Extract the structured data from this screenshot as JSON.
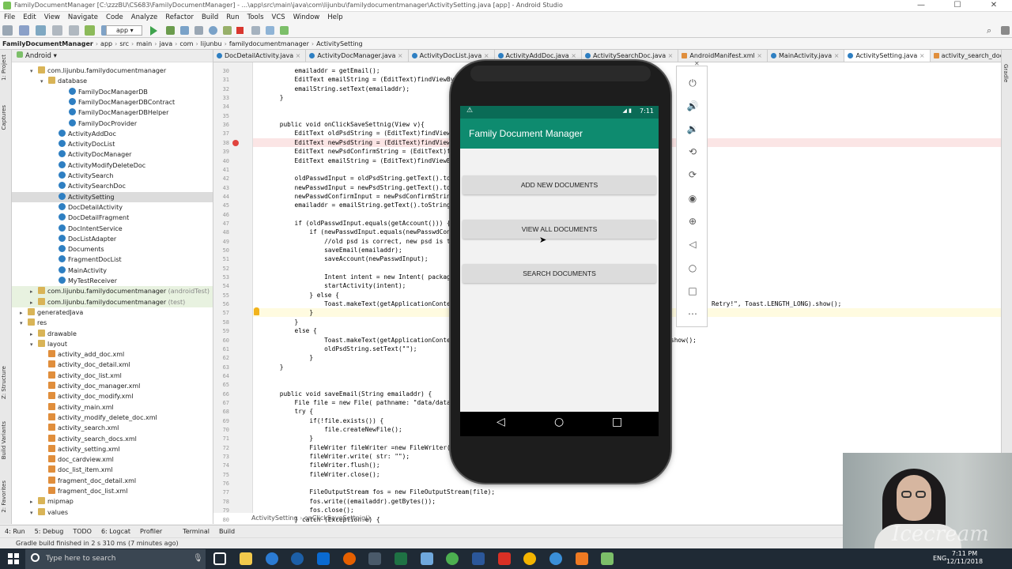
{
  "window": {
    "title": "FamilyDocumentManager [C:\\zzzBU\\CS683\\FamilyDocumentManager] - ...\\app\\src\\main\\java\\com\\lijunbu\\familydocumentmanager\\ActivitySetting.java [app] - Android Studio"
  },
  "menu": [
    "File",
    "Edit",
    "View",
    "Navigate",
    "Code",
    "Analyze",
    "Refactor",
    "Build",
    "Run",
    "Tools",
    "VCS",
    "Window",
    "Help"
  ],
  "toolbar": {
    "run_config": "app"
  },
  "navbar": [
    "FamilyDocumentManager",
    "app",
    "src",
    "main",
    "java",
    "com",
    "lijunbu",
    "familydocumentmanager",
    "ActivitySetting"
  ],
  "project": {
    "view": "Android",
    "rows": [
      {
        "t": "com.lijunbu.familydocumentmanager",
        "k": "f",
        "i": 1,
        "a": "▾"
      },
      {
        "t": "database",
        "k": "f",
        "i": 2,
        "a": "▾"
      },
      {
        "t": "FamilyDocManagerDB",
        "k": "c",
        "i": 4
      },
      {
        "t": "FamilyDocManagerDBContract",
        "k": "c",
        "i": 4
      },
      {
        "t": "FamilyDocManagerDBHelper",
        "k": "c",
        "i": 4
      },
      {
        "t": "FamilyDocProvider",
        "k": "c",
        "i": 4
      },
      {
        "t": "ActivityAddDoc",
        "k": "c",
        "i": 3
      },
      {
        "t": "ActivityDocList",
        "k": "c",
        "i": 3
      },
      {
        "t": "ActivityDocManager",
        "k": "c",
        "i": 3
      },
      {
        "t": "ActivityModifyDeleteDoc",
        "k": "c",
        "i": 3
      },
      {
        "t": "ActivitySearch",
        "k": "c",
        "i": 3
      },
      {
        "t": "ActivitySearchDoc",
        "k": "c",
        "i": 3
      },
      {
        "t": "ActivitySetting",
        "k": "c",
        "i": 3
      },
      {
        "t": "DocDetailActivity",
        "k": "c",
        "i": 3
      },
      {
        "t": "DocDetailFragment",
        "k": "c",
        "i": 3
      },
      {
        "t": "DocIntentService",
        "k": "c",
        "i": 3
      },
      {
        "t": "DocListAdapter",
        "k": "c",
        "i": 3
      },
      {
        "t": "Documents",
        "k": "c",
        "i": 3
      },
      {
        "t": "FragmentDocList",
        "k": "c",
        "i": 3
      },
      {
        "t": "MainActivity",
        "k": "c",
        "i": 3
      },
      {
        "t": "MyTestReceiver",
        "k": "c",
        "i": 3
      },
      {
        "t": "com.lijunbu.familydocumentmanager",
        "m": " (androidTest)",
        "k": "f",
        "i": 1,
        "a": "▸",
        "hl": true
      },
      {
        "t": "com.lijunbu.familydocumentmanager",
        "m": " (test)",
        "k": "f",
        "i": 1,
        "a": "▸",
        "hl": true
      },
      {
        "t": "generatedJava",
        "k": "f",
        "i": 0,
        "a": "▸"
      },
      {
        "t": "res",
        "k": "f",
        "i": 0,
        "a": "▾"
      },
      {
        "t": "drawable",
        "k": "f",
        "i": 1,
        "a": "▸"
      },
      {
        "t": "layout",
        "k": "f",
        "i": 1,
        "a": "▾"
      },
      {
        "t": "activity_add_doc.xml",
        "k": "x",
        "i": 2
      },
      {
        "t": "activity_doc_detail.xml",
        "k": "x",
        "i": 2
      },
      {
        "t": "activity_doc_list.xml",
        "k": "x",
        "i": 2
      },
      {
        "t": "activity_doc_manager.xml",
        "k": "x",
        "i": 2
      },
      {
        "t": "activity_doc_modify.xml",
        "k": "x",
        "i": 2
      },
      {
        "t": "activity_main.xml",
        "k": "x",
        "i": 2
      },
      {
        "t": "activity_modify_delete_doc.xml",
        "k": "x",
        "i": 2
      },
      {
        "t": "activity_search.xml",
        "k": "x",
        "i": 2
      },
      {
        "t": "activity_search_docs.xml",
        "k": "x",
        "i": 2
      },
      {
        "t": "activity_setting.xml",
        "k": "x",
        "i": 2
      },
      {
        "t": "doc_cardview.xml",
        "k": "x",
        "i": 2
      },
      {
        "t": "doc_list_item.xml",
        "k": "x",
        "i": 2
      },
      {
        "t": "fragment_doc_detail.xml",
        "k": "x",
        "i": 2
      },
      {
        "t": "fragment_doc_list.xml",
        "k": "x",
        "i": 2
      },
      {
        "t": "mipmap",
        "k": "f",
        "i": 1,
        "a": "▸"
      },
      {
        "t": "values",
        "k": "f",
        "i": 1,
        "a": "▾"
      }
    ]
  },
  "tabs": [
    "DocDetailActivity.java",
    "ActivityDocManager.java",
    "ActivityDocList.java",
    "ActivityAddDoc.java",
    "ActivitySearchDoc.java",
    "AndroidManifest.xml",
    "MainActivity.java",
    "ActivitySetting.java",
    "activity_search_docs.xml"
  ],
  "active_tab": "ActivitySetting.java",
  "code": {
    "first_line": 30,
    "lines": [
      "        emailaddr = getEmail();",
      "        EditText emailString = (EditText)findViewById(R",
      "        emailString.setText(emailaddr);",
      "    }",
      "",
      "",
      "    public void onClickSaveSettnig(View v){",
      "        EditText oldPsdString = (EditText)findViewById",
      "        EditText newPsdString = (EditText)findViewById",
      "        EditText newPsdConfirmString = (EditText)findV",
      "        EditText emailString = (EditText)findViewById(",
      "",
      "        oldPasswdInput = oldPsdString.getText().toStri",
      "        newPasswdInput = newPsdString.getText().toStri",
      "        newPasswdConfirmInput = newPsdConfirmString.ge",
      "        emailaddr = emailString.getText().toString();",
      "",
      "        if (oldPasswdInput.equals(getAccount())) {",
      "            if (newPasswdInput.equals(newPasswdConfirm",
      "                //old psd is correct, new psd is the s",
      "                saveEmail(emailaddr);",
      "                saveAccount(newPasswdInput);",
      "",
      "                Intent intent = new Intent( packageCont",
      "                startActivity(intent);",
      "            } else {",
      "                Toast.makeText(getApplicationContext()",
      "            }",
      "        }",
      "        else {",
      "                Toast.makeText(getApplicationContext()",
      "                oldPsdString.setText(\"\");",
      "            }",
      "    }",
      "",
      "",
      "    public void saveEmail(String emailaddr) {",
      "        File file = new File( pathname: \"data/data/com.",
      "        try {",
      "            if(!file.exists()) {",
      "                file.createNewFile();",
      "            }",
      "            FileWriter fileWriter =new FileWriter(file",
      "            fileWriter.write( str: \"\");",
      "            fileWriter.flush();",
      "            fileWriter.close();",
      "",
      "            FileOutputStream fos = new FileOutputStream(file);",
      "            fos.write((emailaddr).getBytes());",
      "            fos.close();",
      "        } catch (Exception e) {"
    ],
    "overflow_right_1": "Retry!\", Toast.LENGTH_LONG).show();",
    "overflow_right_2": "show();"
  },
  "editor_breadcrumb": [
    "ActivitySetting",
    "onClickSaveSettnig()"
  ],
  "emulator": {
    "time": "7:11",
    "app_title": "Family Document Manager",
    "buttons": [
      "ADD NEW DOCUMENTS",
      "VIEW ALL DOCUMENTS",
      "SEARCH DOCUMENTS"
    ]
  },
  "bottom_tabs": [
    "4: Run",
    "5: Debug",
    "TODO",
    "6: Logcat",
    "Profiler",
    "Terminal",
    "Build"
  ],
  "status": "Gradle build finished in 2 s 310 ms (7 minutes ago)",
  "left_strip": [
    "1: Project",
    "Captures",
    "Z: Structure",
    "Build Variants",
    "2: Favorites"
  ],
  "right_strip": [
    "Gradle"
  ],
  "taskbar": {
    "search_placeholder": "Type here to search",
    "time": "7:11 PM",
    "date": "12/11/2018",
    "lang": "ENG"
  },
  "colors": {
    "accent": "#0e8b6f",
    "statusbar": "#0a6b56"
  },
  "webcam": {
    "watermark": "Icecream"
  }
}
